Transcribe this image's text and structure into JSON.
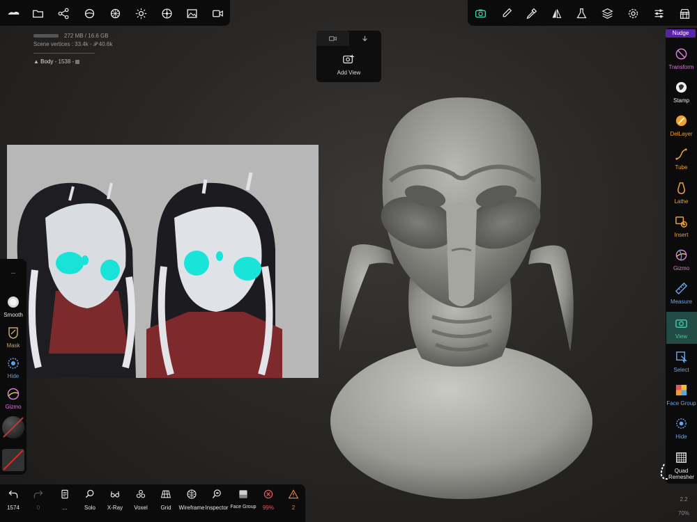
{
  "top_left_toolbar": {
    "icons": [
      "app-menu-icon",
      "folder-icon",
      "scene-graph-icon",
      "material-icon",
      "environment-icon",
      "light-icon",
      "post-process-icon",
      "image-icon",
      "video-icon"
    ]
  },
  "top_right_toolbar": {
    "icons": [
      "camera-icon",
      "brush-icon",
      "eyedropper-icon",
      "symmetry-icon",
      "flask-icon",
      "layers-icon",
      "settings-icon",
      "sliders-icon",
      "scene-icon"
    ]
  },
  "stats": {
    "memory": "272 MB / 16.6 GB",
    "vertices": "Scene vertices : 33.4k - 𝒫 40.6k",
    "object_name": "Body",
    "object_info": "- 1538 -"
  },
  "add_view": {
    "label": "Add View"
  },
  "left_tools": [
    {
      "label": "Smooth",
      "color": "#e9e9e9"
    },
    {
      "label": "Mask",
      "color": "#c7a46b"
    },
    {
      "label": "Hide",
      "color": "#5fa3e0"
    },
    {
      "label": "Gizmo",
      "color": "#d67fd6"
    }
  ],
  "right_tools": {
    "nudge": "Nudge",
    "items": [
      {
        "label": "Transform",
        "color": "#d67fd6"
      },
      {
        "label": "Stamp",
        "color": "#e9e9e9"
      },
      {
        "label": "DelLayer",
        "color": "#f0a030"
      },
      {
        "label": "Tube",
        "color": "#f0a030"
      },
      {
        "label": "Lathe",
        "color": "#f0a030"
      },
      {
        "label": "Insert",
        "color": "#f0a030"
      },
      {
        "label": "Gizmo",
        "color": "#d67fd6"
      },
      {
        "label": "Measure",
        "color": "#6aa6e8"
      },
      {
        "label": "View",
        "color": "#3ec7a4"
      },
      {
        "label": "Select",
        "color": "#6aa6e8"
      },
      {
        "label": "Face Group",
        "color": "#6aa6e8"
      },
      {
        "label": "Hide",
        "color": "#6aa6e8"
      },
      {
        "label": "Quad Remesher",
        "color": "#e9e9e9"
      }
    ]
  },
  "bottom_tools": [
    {
      "label": "1574",
      "icon": "undo-icon"
    },
    {
      "label": "0",
      "icon": "redo-icon"
    },
    {
      "label": "...",
      "icon": "book-icon"
    },
    {
      "label": "Solo",
      "icon": "search-icon"
    },
    {
      "label": "X-Ray",
      "icon": "glasses-icon"
    },
    {
      "label": "Voxel",
      "icon": "voxel-icon"
    },
    {
      "label": "Grid",
      "icon": "grid-icon"
    },
    {
      "label": "Wireframe",
      "icon": "wireframe-icon"
    },
    {
      "label": "Inspector",
      "icon": "inspector-icon"
    },
    {
      "label": "Face Group",
      "icon": "face-group-icon"
    },
    {
      "label": "99%",
      "icon": "error-icon"
    },
    {
      "label": "2",
      "icon": "warning-icon"
    }
  ],
  "zoom": {
    "scale": "2.2",
    "percent": "70%"
  },
  "colors": {
    "accent": "#3ec7a4",
    "nudge": "#5a22a7",
    "error": "#e05a5a",
    "warning": "#e6803a"
  }
}
